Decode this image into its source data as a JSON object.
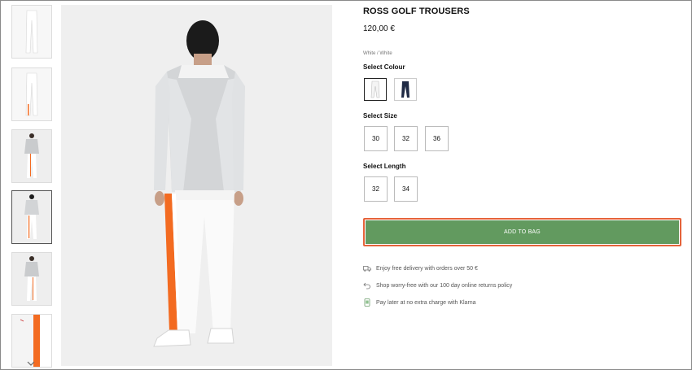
{
  "product": {
    "title": "ROSS GOLF TROUSERS",
    "price": "120,00 €",
    "selected_colour_name": "White / White"
  },
  "colour": {
    "label": "Select Colour",
    "swatches": [
      {
        "name": "White",
        "color": "#f4f4f4"
      },
      {
        "name": "Navy",
        "color": "#1f2a44"
      }
    ]
  },
  "size": {
    "label": "Select Size",
    "options": [
      "30",
      "32",
      "36"
    ]
  },
  "length": {
    "label": "Select Length",
    "options": [
      "32",
      "34"
    ]
  },
  "cta": {
    "add_to_bag": "ADD TO BAG",
    "color": "#629a5f",
    "focus_color": "#e5633a"
  },
  "info": [
    {
      "icon": "truck-icon",
      "text": "Enjoy free delivery with orders over 50 €"
    },
    {
      "icon": "return-arrow-icon",
      "text": "Shop worry-free with our 100 day online returns policy"
    },
    {
      "icon": "klarna-icon",
      "text": "Pay later at no extra charge with Klarna"
    }
  ],
  "gallery": {
    "accent_color": "#f36b21",
    "thumbnails": [
      "thumb-trousers-front",
      "thumb-trousers-back",
      "thumb-model-front",
      "thumb-model-back",
      "thumb-model-side",
      "thumb-stripe-detail"
    ],
    "scroll_icon": "chevron-down-icon"
  }
}
